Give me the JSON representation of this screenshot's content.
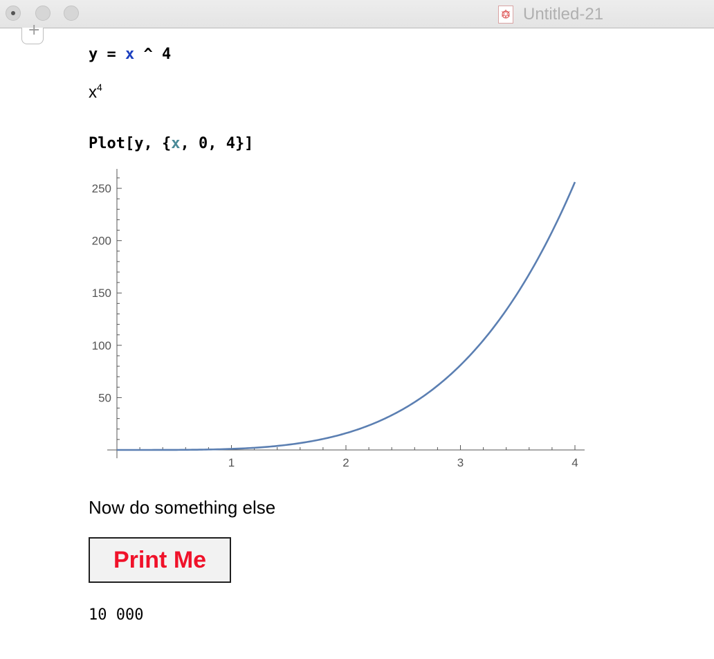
{
  "window": {
    "title": "Untitled-21"
  },
  "cells": {
    "input1": {
      "lhs": "y",
      "eq": " = ",
      "var": "x",
      "rest": " ^ 4"
    },
    "output1": {
      "base": "x",
      "exponent": "4"
    },
    "input2": {
      "pre": "Plot[y, {",
      "var": "x",
      "post": ", 0, 4}]"
    },
    "text": "Now do something else",
    "button_label": "Print Me",
    "output3": "10 000"
  },
  "colors": {
    "curve": "#5b7fb2",
    "button_text": "#f0122a",
    "var_blue": "#1b3fbf",
    "var_teal": "#4a8a98"
  },
  "chart_data": {
    "type": "line",
    "function": "x^4",
    "x_range": [
      0,
      4
    ],
    "y_range": [
      0,
      256
    ],
    "xticks": [
      "1",
      "2",
      "3",
      "4"
    ],
    "yticks": [
      "50",
      "100",
      "150",
      "200",
      "250"
    ],
    "series": [
      {
        "x": [
          0,
          0.5,
          1,
          1.5,
          2,
          2.5,
          3,
          3.5,
          4
        ],
        "y": [
          0,
          0.0625,
          1,
          5.0625,
          16,
          39.0625,
          81,
          150.0625,
          256
        ]
      }
    ]
  }
}
